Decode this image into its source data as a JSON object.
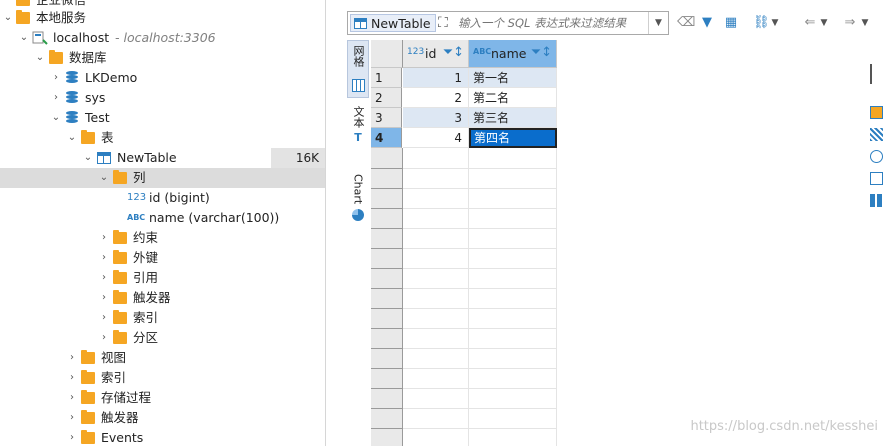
{
  "tree": {
    "top_partial": "企业微信",
    "local_service": "本地服务",
    "connection": {
      "name": "localhost",
      "host": "- localhost:3306"
    },
    "databases_folder": "数据库",
    "databases": [
      "LKDemo",
      "sys",
      "Test"
    ],
    "tables_folder": "表",
    "table": {
      "name": "NewTable",
      "size": "16K"
    },
    "columns_folder": "列",
    "columns": [
      "id (bigint)",
      "name (varchar(100))"
    ],
    "table_children": [
      "约束",
      "外键",
      "引用",
      "触发器",
      "索引",
      "分区"
    ],
    "db_children": [
      "视图",
      "索引",
      "存储过程",
      "触发器",
      "Events"
    ]
  },
  "toolbar": {
    "table_tab": "NewTable",
    "filter_placeholder": "输入一个 SQL 表达式来过滤结果"
  },
  "vtabs": [
    "网格",
    "文本",
    "Chart"
  ],
  "grid": {
    "headers": [
      {
        "type": "123",
        "name": "id"
      },
      {
        "type": "ABC",
        "name": "name"
      }
    ],
    "rows": [
      {
        "n": "1",
        "id": "1",
        "name": "第一名"
      },
      {
        "n": "2",
        "id": "2",
        "name": "第二名"
      },
      {
        "n": "3",
        "id": "3",
        "name": "第三名"
      },
      {
        "n": "4",
        "id": "4",
        "name": "第四名"
      }
    ]
  },
  "watermark": "https://blog.csdn.net/kesshei"
}
